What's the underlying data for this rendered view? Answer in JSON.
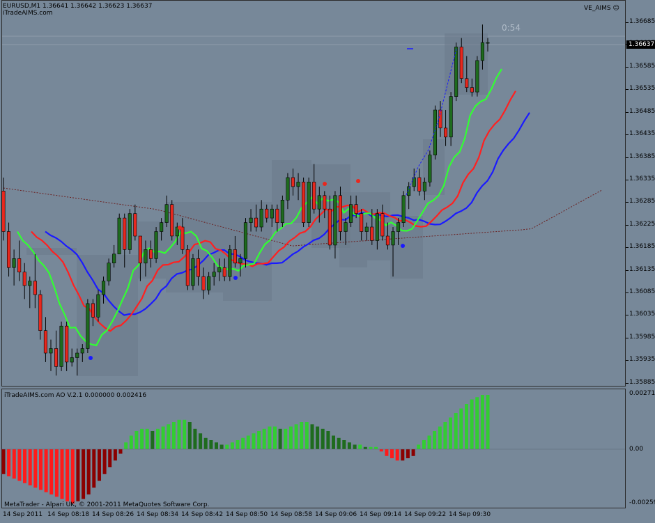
{
  "chart_header": {
    "symbol_line": "EURUSD,M1  1.36641 1.36642 1.36623 1.36637",
    "watermark": "iTradeAIMS.com",
    "indicator_name": "VE_AIMS",
    "smiley": "☺",
    "countdown": "0:54"
  },
  "price_axis": {
    "labels": [
      "1.36685",
      "1.36637",
      "1.36585",
      "1.36535",
      "1.36485",
      "1.36435",
      "1.36385",
      "1.36335",
      "1.36285",
      "1.36225",
      "1.36185",
      "1.36135",
      "1.36085",
      "1.36035",
      "1.35985",
      "1.35935",
      "1.35885"
    ],
    "current_price": "1.36637"
  },
  "ao_panel": {
    "title": "iTradeAIMS.com AO V.2.1 0.000000 0.002416",
    "axis_labels": [
      "0.002712",
      "0.00",
      "-0.00259"
    ],
    "copyright": "MetaTrader - Alpari UK, © 2001-2011 MetaQuotes Software Corp."
  },
  "time_axis": {
    "labels": [
      "14 Sep 2011",
      "14 Sep 08:18",
      "14 Sep 08:26",
      "14 Sep 08:34",
      "14 Sep 08:42",
      "14 Sep 08:50",
      "14 Sep 08:58",
      "14 Sep 09:06",
      "14 Sep 09:14",
      "14 Sep 09:22",
      "14 Sep 09:30"
    ]
  },
  "colors": {
    "background": "#778899",
    "bull_candle": "#1e6b1e",
    "bear_candle": "#e8281e",
    "ma_fast": "#32ff32",
    "ma_mid": "#ff2020",
    "ma_slow": "#1a1aff",
    "box_shade": "#6b7a8a",
    "ao_up_light": "#32cd32",
    "ao_up_dark": "#1e6b1e",
    "ao_down_light": "#ff1a1a",
    "ao_down_dark": "#8b0000"
  },
  "chart_data": {
    "type": "candlestick",
    "ylim": [
      1.35885,
      1.36715
    ],
    "candles_ohlc": [
      [
        1.3631,
        1.3634,
        1.362,
        1.3622
      ],
      [
        1.3622,
        1.3624,
        1.3612,
        1.3614
      ],
      [
        1.3614,
        1.3618,
        1.361,
        1.3616
      ],
      [
        1.3616,
        1.362,
        1.3611,
        1.3613
      ],
      [
        1.3613,
        1.3615,
        1.3607,
        1.361
      ],
      [
        1.361,
        1.3612,
        1.3605,
        1.3611
      ],
      [
        1.3611,
        1.3617,
        1.3605,
        1.3608
      ],
      [
        1.3608,
        1.3609,
        1.3598,
        1.36
      ],
      [
        1.36,
        1.3603,
        1.3593,
        1.3595
      ],
      [
        1.3595,
        1.3598,
        1.3591,
        1.3596
      ],
      [
        1.3596,
        1.36,
        1.359,
        1.3592
      ],
      [
        1.3592,
        1.3602,
        1.3591,
        1.3601
      ],
      [
        1.3601,
        1.3602,
        1.3591,
        1.3593
      ],
      [
        1.3593,
        1.3596,
        1.3592,
        1.3594
      ],
      [
        1.3594,
        1.3596,
        1.359,
        1.3595
      ],
      [
        1.3595,
        1.3597,
        1.3593,
        1.3596
      ],
      [
        1.3596,
        1.3607,
        1.3595,
        1.3606
      ],
      [
        1.3606,
        1.3607,
        1.3601,
        1.3603
      ],
      [
        1.3603,
        1.3609,
        1.3602,
        1.3608
      ],
      [
        1.3608,
        1.3612,
        1.3606,
        1.3611
      ],
      [
        1.3611,
        1.3616,
        1.361,
        1.3615
      ],
      [
        1.3615,
        1.3619,
        1.3614,
        1.3617
      ],
      [
        1.3617,
        1.3626,
        1.3617,
        1.3625
      ],
      [
        1.3625,
        1.3626,
        1.3614,
        1.3618
      ],
      [
        1.3618,
        1.3627,
        1.3617,
        1.3626
      ],
      [
        1.3626,
        1.3628,
        1.362,
        1.3621
      ],
      [
        1.3621,
        1.3621,
        1.3611,
        1.3615
      ],
      [
        1.3615,
        1.362,
        1.3612,
        1.3618
      ],
      [
        1.3618,
        1.362,
        1.3614,
        1.3616
      ],
      [
        1.3616,
        1.3623,
        1.3615,
        1.3622
      ],
      [
        1.3622,
        1.3625,
        1.362,
        1.3624
      ],
      [
        1.3624,
        1.363,
        1.3623,
        1.3628
      ],
      [
        1.3628,
        1.3629,
        1.362,
        1.3621
      ],
      [
        1.3621,
        1.3624,
        1.3619,
        1.3623
      ],
      [
        1.3623,
        1.3625,
        1.3617,
        1.3618
      ],
      [
        1.3618,
        1.3619,
        1.3609,
        1.361
      ],
      [
        1.361,
        1.3617,
        1.3609,
        1.3616
      ],
      [
        1.3616,
        1.3618,
        1.361,
        1.3612
      ],
      [
        1.3612,
        1.3614,
        1.3607,
        1.3609
      ],
      [
        1.3609,
        1.3613,
        1.3608,
        1.3612
      ],
      [
        1.3612,
        1.3615,
        1.361,
        1.3613
      ],
      [
        1.3613,
        1.3616,
        1.3611,
        1.3614
      ],
      [
        1.3614,
        1.3616,
        1.3611,
        1.3612
      ],
      [
        1.3612,
        1.3619,
        1.3611,
        1.3618
      ],
      [
        1.3618,
        1.3621,
        1.3614,
        1.3615
      ],
      [
        1.3615,
        1.3617,
        1.3612,
        1.3616
      ],
      [
        1.3616,
        1.3625,
        1.3614,
        1.3624
      ],
      [
        1.3624,
        1.3627,
        1.3622,
        1.3625
      ],
      [
        1.3625,
        1.3628,
        1.3622,
        1.3623
      ],
      [
        1.3623,
        1.3629,
        1.3622,
        1.3627
      ],
      [
        1.3627,
        1.3628,
        1.3624,
        1.3625
      ],
      [
        1.3625,
        1.3628,
        1.3623,
        1.3627
      ],
      [
        1.3627,
        1.3628,
        1.3622,
        1.3624
      ],
      [
        1.3624,
        1.363,
        1.3623,
        1.3629
      ],
      [
        1.3629,
        1.3635,
        1.3627,
        1.3634
      ],
      [
        1.3634,
        1.3636,
        1.363,
        1.3632
      ],
      [
        1.3632,
        1.3635,
        1.3629,
        1.3633
      ],
      [
        1.3633,
        1.3634,
        1.3623,
        1.3624
      ],
      [
        1.3624,
        1.3634,
        1.3623,
        1.3633
      ],
      [
        1.3633,
        1.3637,
        1.3626,
        1.3627
      ],
      [
        1.3627,
        1.3632,
        1.3624,
        1.363
      ],
      [
        1.363,
        1.3631,
        1.3625,
        1.3627
      ],
      [
        1.3627,
        1.363,
        1.3618,
        1.3619
      ],
      [
        1.3619,
        1.3631,
        1.3616,
        1.363
      ],
      [
        1.363,
        1.3632,
        1.362,
        1.3622
      ],
      [
        1.3622,
        1.3625,
        1.3619,
        1.3624
      ],
      [
        1.3624,
        1.363,
        1.3623,
        1.3628
      ],
      [
        1.3628,
        1.363,
        1.3625,
        1.3626
      ],
      [
        1.3626,
        1.3627,
        1.362,
        1.3622
      ],
      [
        1.3622,
        1.3624,
        1.362,
        1.3623
      ],
      [
        1.3623,
        1.3627,
        1.3619,
        1.362
      ],
      [
        1.362,
        1.3627,
        1.3618,
        1.3626
      ],
      [
        1.3626,
        1.3628,
        1.362,
        1.3621
      ],
      [
        1.3621,
        1.3624,
        1.3618,
        1.3619
      ],
      [
        1.3619,
        1.3623,
        1.3612,
        1.3622
      ],
      [
        1.3622,
        1.3625,
        1.3619,
        1.3624
      ],
      [
        1.3624,
        1.3631,
        1.3623,
        1.363
      ],
      [
        1.363,
        1.3633,
        1.3627,
        1.3632
      ],
      [
        1.3632,
        1.3636,
        1.3631,
        1.3634
      ],
      [
        1.3634,
        1.3636,
        1.363,
        1.3631
      ],
      [
        1.3631,
        1.3634,
        1.3629,
        1.3633
      ],
      [
        1.3633,
        1.364,
        1.3632,
        1.3639
      ],
      [
        1.3639,
        1.365,
        1.3638,
        1.3649
      ],
      [
        1.3649,
        1.3651,
        1.3643,
        1.3645
      ],
      [
        1.3645,
        1.3649,
        1.3641,
        1.3643
      ],
      [
        1.3643,
        1.3653,
        1.3641,
        1.3652
      ],
      [
        1.3652,
        1.3664,
        1.3651,
        1.3663
      ],
      [
        1.3663,
        1.3665,
        1.3655,
        1.3656
      ],
      [
        1.3656,
        1.3661,
        1.3653,
        1.3654
      ],
      [
        1.3654,
        1.3656,
        1.3652,
        1.3653
      ],
      [
        1.3653,
        1.3661,
        1.3652,
        1.366
      ],
      [
        1.366,
        1.3668,
        1.3658,
        1.3664
      ],
      [
        1.3664,
        1.3665,
        1.3662,
        1.3664
      ]
    ],
    "ao_values": [
      -0.0011,
      -0.0012,
      -0.0013,
      -0.0014,
      -0.0015,
      -0.0016,
      -0.0017,
      -0.0018,
      -0.0019,
      -0.002,
      -0.0021,
      -0.0022,
      -0.0023,
      -0.0024,
      -0.0023,
      -0.0022,
      -0.002,
      -0.0017,
      -0.0014,
      -0.0011,
      -0.0008,
      -0.0005,
      -0.0002,
      0.0003,
      0.0006,
      0.0008,
      0.0009,
      0.0009,
      0.0008,
      0.0009,
      0.001,
      0.0011,
      0.0012,
      0.0013,
      0.0013,
      0.0012,
      0.0009,
      0.0007,
      0.0005,
      0.0004,
      0.0003,
      0.0002,
      0.0002,
      0.0003,
      0.0004,
      0.0005,
      0.0006,
      0.0007,
      0.0008,
      0.0009,
      0.001,
      0.001,
      0.0009,
      0.0009,
      0.001,
      0.0011,
      0.0012,
      0.0012,
      0.0011,
      0.001,
      0.0009,
      0.0008,
      0.0006,
      0.0005,
      0.0004,
      0.0003,
      0.0002,
      0.0002,
      0.0001,
      0.0001,
      0.0001,
      -0.0001,
      -0.0003,
      -0.0004,
      -0.0005,
      -0.0005,
      -0.0004,
      -0.0003,
      0.0002,
      0.0004,
      0.0006,
      0.0008,
      0.001,
      0.0012,
      0.0014,
      0.0016,
      0.0018,
      0.002,
      0.0022,
      0.0023,
      0.0024,
      0.0024
    ]
  }
}
